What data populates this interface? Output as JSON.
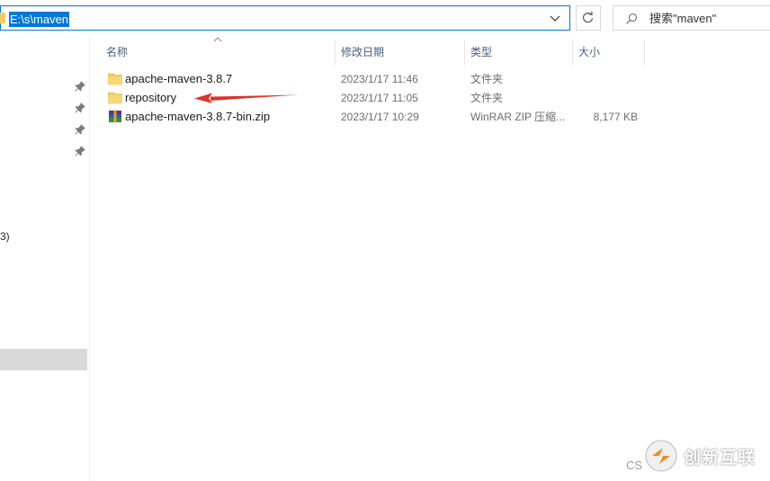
{
  "address_bar": {
    "path": "E:\\s\\maven"
  },
  "search": {
    "placeholder": "搜索\"maven\""
  },
  "nav_pane": {
    "partial_label": "3)"
  },
  "columns": {
    "name": "名称",
    "date": "修改日期",
    "type": "类型",
    "size": "大小"
  },
  "files": [
    {
      "name": "apache-maven-3.8.7",
      "date": "2023/1/17 11:46",
      "type": "文件夹",
      "size": "",
      "icon": "folder-icon"
    },
    {
      "name": "repository",
      "date": "2023/1/17 11:05",
      "type": "文件夹",
      "size": "",
      "icon": "folder-icon"
    },
    {
      "name": "apache-maven-3.8.7-bin.zip",
      "date": "2023/1/17 10:29",
      "type": "WinRAR ZIP 压缩...",
      "size": "8,177 KB",
      "icon": "winrar-archive-icon"
    }
  ],
  "watermark": {
    "cs_text": "CS",
    "brand_text": "创新互联"
  },
  "colors": {
    "accent": "#0078d7",
    "folder": "#f2cd62",
    "annotation_arrow": "#d9342b"
  }
}
